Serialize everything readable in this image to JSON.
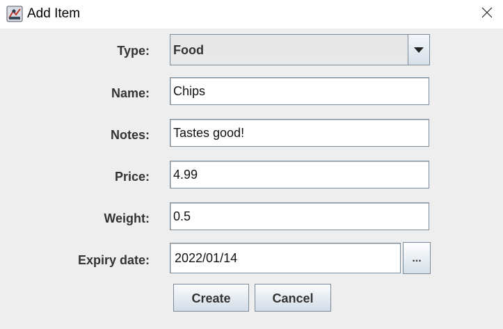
{
  "window": {
    "title": "Add Item",
    "close_icon": "close-icon",
    "app_icon": "java-app-icon"
  },
  "form": {
    "type": {
      "label": "Type:",
      "value": "Food"
    },
    "name": {
      "label": "Name:",
      "value": "Chips"
    },
    "notes": {
      "label": "Notes:",
      "value": "Tastes good!"
    },
    "price": {
      "label": "Price:",
      "value": "4.99"
    },
    "weight": {
      "label": "Weight:",
      "value": "0.5"
    },
    "expiry": {
      "label": "Expiry date:",
      "value": "2022/01/14",
      "picker_label": "..."
    }
  },
  "actions": {
    "create_label": "Create",
    "cancel_label": "Cancel"
  },
  "colors": {
    "background": "#eeeeee",
    "border": "#7a8a99",
    "label_text": "#333333"
  }
}
